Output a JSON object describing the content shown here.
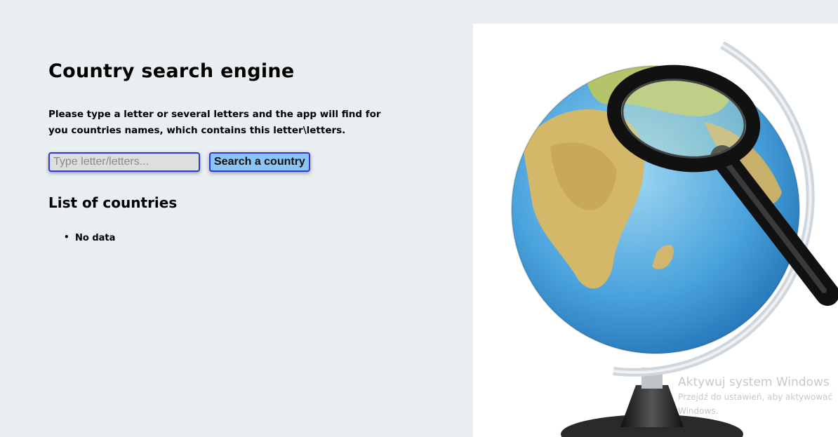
{
  "page": {
    "title": "Country search engine",
    "description": "Please type a letter or several letters and the app will find for you countries names, which contains this letter\\letters."
  },
  "search": {
    "placeholder": "Type letter/letters...",
    "value": "",
    "button_label": "Search a country"
  },
  "list": {
    "heading": "List of countries",
    "items": [
      "No data"
    ]
  },
  "image": {
    "subject": "globe-with-magnifying-glass"
  },
  "watermark": {
    "title": "Aktywuj system Windows",
    "line1": "Przejdź do ustawień, aby aktywować",
    "line2": "Windows."
  },
  "colors": {
    "background": "#e9eef0",
    "button_bg": "#8cc4f4",
    "border_accent": "#2e3ad6",
    "input_bg": "#dcdedf"
  }
}
